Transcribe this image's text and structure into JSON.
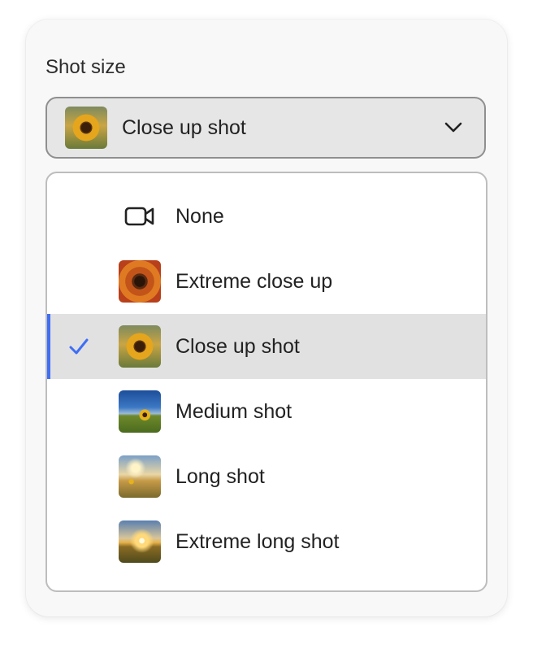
{
  "field": {
    "label": "Shot size"
  },
  "picker": {
    "selected_value": "Close up shot",
    "selected_thumbnail": "sunflower-close-up-thumbnail",
    "toggle_icon": "chevron-down-icon"
  },
  "menu": {
    "items": [
      {
        "label": "None",
        "icon": "video-camera-icon",
        "selected": false
      },
      {
        "label": "Extreme close up",
        "icon": "sunflower-extreme-close-up-thumbnail",
        "selected": false
      },
      {
        "label": "Close up shot",
        "icon": "sunflower-close-up-thumbnail",
        "selected": true
      },
      {
        "label": "Medium shot",
        "icon": "sunflower-medium-shot-thumbnail",
        "selected": false
      },
      {
        "label": "Long shot",
        "icon": "sunflower-long-shot-thumbnail",
        "selected": false
      },
      {
        "label": "Extreme long shot",
        "icon": "sunflower-extreme-long-shot-thumbnail",
        "selected": false
      }
    ],
    "selected_icon": "checkmark-icon"
  },
  "colors": {
    "accent": "#3f6ef5",
    "card_background": "#f8f8f8",
    "picker_background": "#e6e6e6",
    "selected_row_background": "#e1e1e1"
  }
}
